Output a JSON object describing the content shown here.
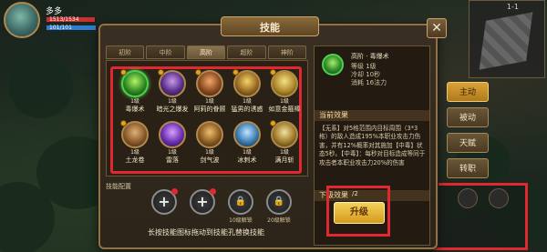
{
  "hud": {
    "name": "多多",
    "hp_text": "1513/1534",
    "hp_fraction": 0.986,
    "mp_text": "101/101",
    "mp_fraction": 1.0
  },
  "map": {
    "label": "1-1"
  },
  "dialog": {
    "title": "技能",
    "close_label": "✕"
  },
  "tabs": [
    {
      "label": "初阶",
      "active": false
    },
    {
      "label": "中阶",
      "active": false
    },
    {
      "label": "高阶",
      "active": true
    },
    {
      "label": "超阶",
      "active": false
    },
    {
      "label": "神阶",
      "active": false
    }
  ],
  "skills": [
    {
      "level": "1级",
      "name": "毒爆术",
      "colors": [
        "#b7f36a",
        "#2e8a22",
        "#0f2b13"
      ],
      "selected": true,
      "lock": true
    },
    {
      "level": "1级",
      "name": "暗光之爆发",
      "colors": [
        "#c79be8",
        "#5a2f8a",
        "#1a0f2b"
      ],
      "selected": false,
      "lock": true
    },
    {
      "level": "1级",
      "name": "阿莉的眷顾",
      "colors": [
        "#f0a86a",
        "#8a4a22",
        "#2b160a"
      ],
      "selected": false,
      "lock": true
    },
    {
      "level": "1级",
      "name": "猛男的诱惑",
      "colors": [
        "#f3d46a",
        "#9a6a22",
        "#2b1d0a"
      ],
      "selected": false,
      "lock": true
    },
    {
      "level": "1级",
      "name": "如意金箍棒",
      "colors": [
        "#f6e08a",
        "#b08a2a",
        "#3b2a0a"
      ],
      "selected": false,
      "lock": true
    },
    {
      "level": "1级",
      "name": "土龙卷",
      "colors": [
        "#e0b07a",
        "#8a5a2a",
        "#2b1a0a"
      ],
      "selected": false,
      "lock": true
    },
    {
      "level": "1级",
      "name": "雷落",
      "colors": [
        "#d6a0ff",
        "#6a2fb0",
        "#1c0a33"
      ],
      "selected": false,
      "lock": false
    },
    {
      "level": "1级",
      "name": "剑气波",
      "colors": [
        "#f0c070",
        "#8a5a22",
        "#2b180a"
      ],
      "selected": false,
      "lock": false
    },
    {
      "level": "1级",
      "name": "冰刺术",
      "colors": [
        "#bfe6ff",
        "#3a7ab0",
        "#0a1c2b"
      ],
      "selected": false,
      "lock": false
    },
    {
      "level": "1级",
      "name": "满月斩",
      "colors": [
        "#f0e2a0",
        "#a07a2a",
        "#2b200a"
      ],
      "selected": false,
      "lock": true
    }
  ],
  "config": {
    "label": "技能配置",
    "slots": [
      {
        "symbol": "+",
        "badge": true,
        "caption": ""
      },
      {
        "symbol": "+",
        "badge": true,
        "caption": ""
      },
      {
        "symbol": "🔒",
        "badge": false,
        "caption": "10级解锁"
      },
      {
        "symbol": "🔒",
        "badge": false,
        "caption": "20级解锁"
      }
    ],
    "hint": "长按技能图标拖动到技能孔替换技能"
  },
  "detail": {
    "tag": "高阶 · 毒爆术",
    "level_line": "等级 1级",
    "cooldown_line": "冷却 10秒",
    "cost_line": "消耗 16法力",
    "current_head": "当前效果",
    "current_desc": "【无系】对5格范围内目标周围（3*3格）的敌人造成195%本职业攻击力伤害，并有12%概率对其施加【中毒】状态5秒。【中毒】：每秒对目标造成等同于攻击者本职业攻击力20%的伤害",
    "next_head": "下级效果",
    "cost_tag": "/2",
    "upgrade_label": "升级"
  },
  "side_menu": [
    {
      "label": "主动",
      "active": true
    },
    {
      "label": "被动",
      "active": false
    },
    {
      "label": "天赋",
      "active": false
    },
    {
      "label": "转职",
      "active": false
    }
  ]
}
